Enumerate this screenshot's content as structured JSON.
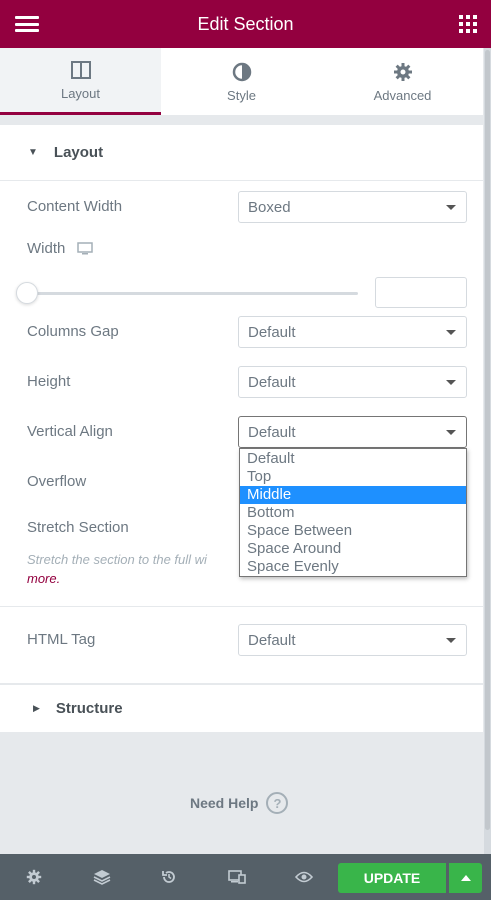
{
  "header": {
    "title": "Edit Section"
  },
  "tabs": [
    {
      "label": "Layout",
      "icon": "columns-icon",
      "active": true
    },
    {
      "label": "Style",
      "icon": "contrast-icon",
      "active": false
    },
    {
      "label": "Advanced",
      "icon": "gear-icon",
      "active": false
    }
  ],
  "layout_section": {
    "title": "Layout",
    "content_width": {
      "label": "Content Width",
      "value": "Boxed"
    },
    "width": {
      "label": "Width",
      "slider_fraction": 0,
      "input_value": ""
    },
    "columns_gap": {
      "label": "Columns Gap",
      "value": "Default"
    },
    "height": {
      "label": "Height",
      "value": "Default"
    },
    "vertical_align": {
      "label": "Vertical Align",
      "value": "Default",
      "options": [
        "Default",
        "Top",
        "Middle",
        "Bottom",
        "Space Between",
        "Space Around",
        "Space Evenly"
      ],
      "highlighted": "Middle"
    },
    "overflow": {
      "label": "Overflow"
    },
    "stretch_section": {
      "label": "Stretch Section",
      "description": "Stretch the section to the full wi",
      "more_link": "more."
    },
    "html_tag": {
      "label": "HTML Tag",
      "value": "Default"
    }
  },
  "structure_section": {
    "title": "Structure"
  },
  "help": {
    "label": "Need Help"
  },
  "footer": {
    "update_label": "UPDATE"
  },
  "colors": {
    "brand": "#93003f",
    "update_green": "#39b54a",
    "footer_bg": "#556068",
    "highlight": "#1e90ff"
  }
}
